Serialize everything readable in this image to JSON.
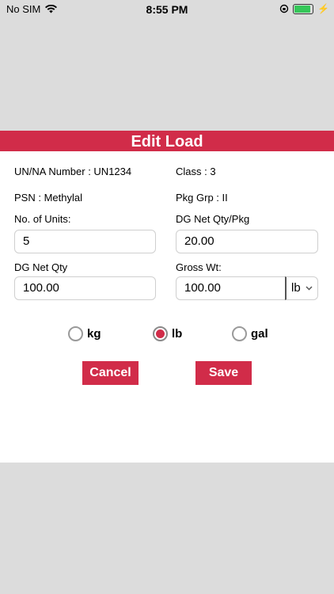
{
  "status_bar": {
    "carrier": "No SIM",
    "time": "8:55 PM",
    "battery_level": 0.9
  },
  "header": {
    "title": "Edit Load"
  },
  "info": {
    "un_number": "UN/NA Number : UN1234",
    "class": "Class : 3",
    "psn": "PSN : Methylal",
    "pkg_grp": "Pkg Grp : II"
  },
  "fields": {
    "units_label": "No. of Units:",
    "units_value": "5",
    "dg_net_qty_pkg_label": "DG Net Qty/Pkg",
    "dg_net_qty_pkg_value": "20.00",
    "dg_net_qty_label": "DG Net Qty",
    "dg_net_qty_value": "100.00",
    "gross_wt_label": "Gross Wt:",
    "gross_wt_value": "100.00",
    "gross_wt_unit": "lb"
  },
  "units_radio": {
    "options": [
      "kg",
      "lb",
      "gal"
    ],
    "selected": "lb"
  },
  "buttons": {
    "cancel": "Cancel",
    "save": "Save"
  },
  "colors": {
    "accent": "#d12c49",
    "background": "#dcdcdc"
  }
}
